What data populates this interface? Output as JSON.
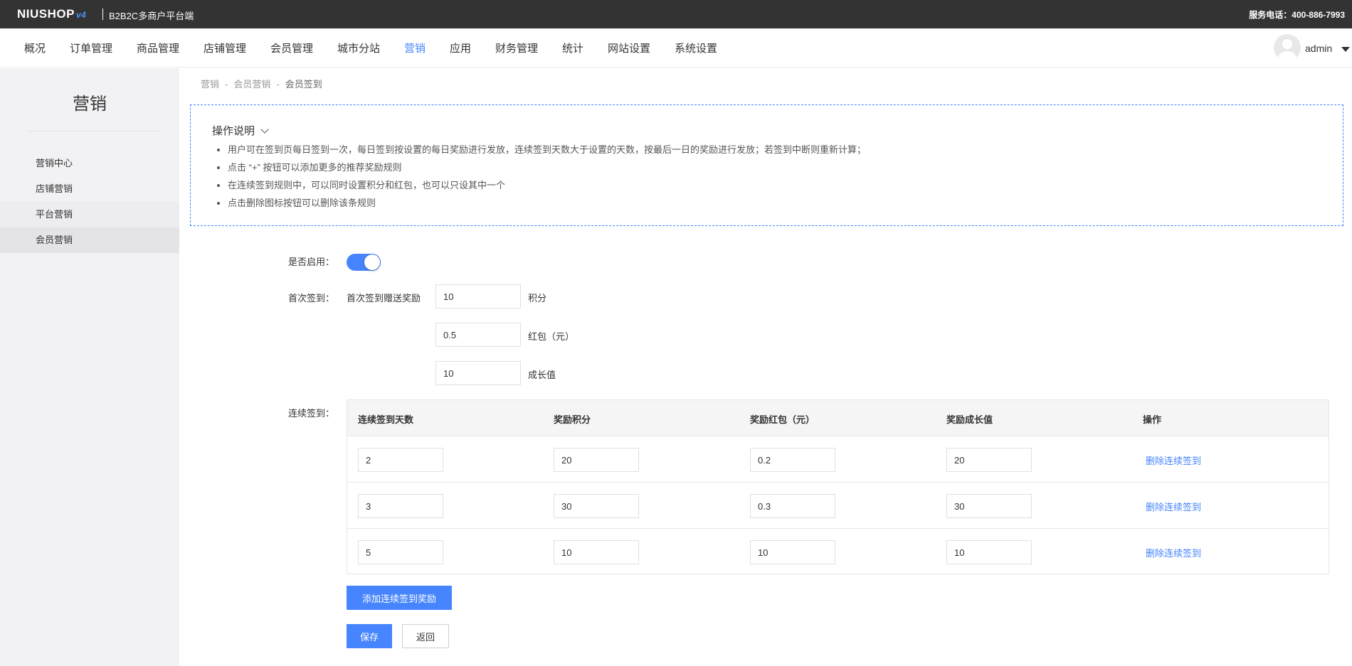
{
  "header": {
    "logo_text": "NIUSHOP",
    "logo_version": "v4",
    "subtitle": "B2B2C多商户平台端",
    "hotline": "服务电话：400-886-7993"
  },
  "nav": {
    "items": [
      "概况",
      "订单管理",
      "商品管理",
      "店铺管理",
      "会员管理",
      "城市分站",
      "营销",
      "应用",
      "财务管理",
      "统计",
      "网站设置",
      "系统设置"
    ],
    "active": "营销",
    "username": "admin"
  },
  "sidebar": {
    "title": "营销",
    "items": [
      "营销中心",
      "店铺营销",
      "平台营销",
      "会员营销"
    ],
    "active": "会员营销"
  },
  "breadcrumb": [
    "营销",
    "会员营销",
    "会员签到"
  ],
  "tips": {
    "title": "操作说明",
    "items": [
      "用户可在签到页每日签到一次，每日签到按设置的每日奖励进行发放，连续签到天数大于设置的天数，按最后一日的奖励进行发放；若签到中断则重新计算；",
      "点击 “+” 按钮可以添加更多的推荐奖励规则",
      "在连续签到规则中，可以同时设置积分和红包，也可以只设其中一个",
      "点击删除图标按钮可以删除该条规则"
    ]
  },
  "form": {
    "enable_label": "是否启用：",
    "enabled": true,
    "first_label": "首次签到：",
    "first_desc": "首次签到赠送奖励",
    "first_points": "10",
    "points_unit": "积分",
    "first_redpacket": "0.5",
    "redpacket_unit": "红包（元）",
    "first_growth": "10",
    "growth_unit": "成长值",
    "continuous_label": "连续签到："
  },
  "table": {
    "headers": [
      "连续签到天数",
      "奖励积分",
      "奖励红包（元）",
      "奖励成长值",
      "操作"
    ],
    "rows": [
      {
        "days": "2",
        "points": "20",
        "redpacket": "0.2",
        "growth": "20",
        "action": "删除连续签到"
      },
      {
        "days": "3",
        "points": "30",
        "redpacket": "0.3",
        "growth": "30",
        "action": "删除连续签到"
      },
      {
        "days": "5",
        "points": "10",
        "redpacket": "10",
        "growth": "10",
        "action": "删除连续签到"
      }
    ]
  },
  "buttons": {
    "add": "添加连续签到奖励",
    "save": "保存",
    "back": "返回"
  },
  "colors": {
    "primary": "#4685fd",
    "topbar": "#333333",
    "sidebar": "#f2f2f4"
  }
}
